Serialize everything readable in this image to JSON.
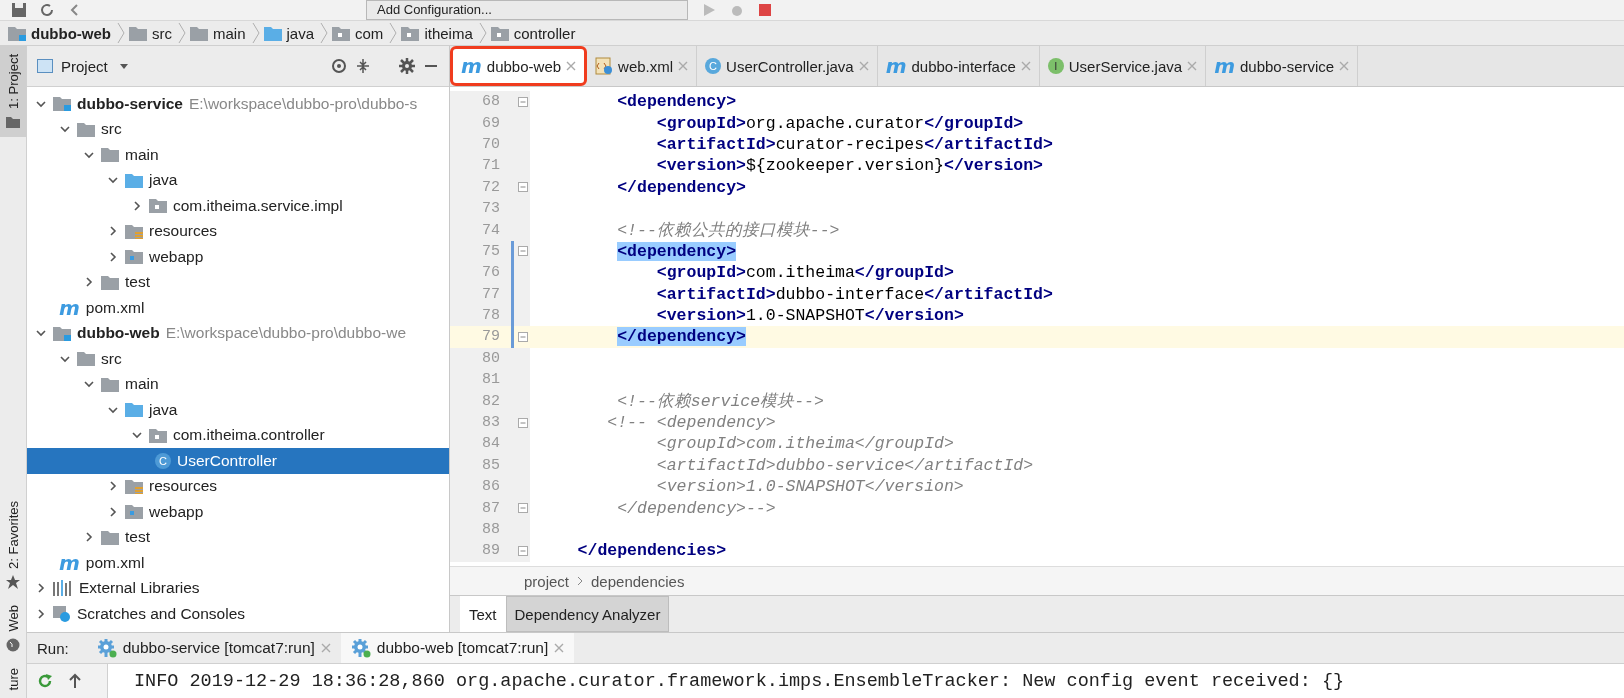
{
  "toolbar": {
    "run_config": "Add Configuration..."
  },
  "breadcrumb": [
    {
      "label": "dubbo-web",
      "kind": "module"
    },
    {
      "label": "src",
      "kind": "folder"
    },
    {
      "label": "main",
      "kind": "folder"
    },
    {
      "label": "java",
      "kind": "source"
    },
    {
      "label": "com",
      "kind": "package"
    },
    {
      "label": "itheima",
      "kind": "package"
    },
    {
      "label": "controller",
      "kind": "package"
    }
  ],
  "tool_strip": [
    {
      "label": "1: Project",
      "kind": "project",
      "selected": true
    },
    {
      "label": "2: Favorites",
      "kind": "favorites",
      "selected": false
    },
    {
      "label": "Web",
      "kind": "web",
      "selected": false
    },
    {
      "label": "ture",
      "kind": "structure",
      "selected": false
    }
  ],
  "project_panel": {
    "title": "Project",
    "tree": [
      {
        "label": "dubbo-service",
        "kind": "module",
        "path": "E:\\workspace\\dubbo-pro\\dubbo-s",
        "expanded": true,
        "selected": false,
        "children": [
          {
            "label": "src",
            "kind": "folder",
            "expanded": true,
            "selected": false,
            "children": [
              {
                "label": "main",
                "kind": "folder",
                "expanded": true,
                "selected": false,
                "children": [
                  {
                    "label": "java",
                    "kind": "source",
                    "expanded": true,
                    "selected": false,
                    "children": [
                      {
                        "label": "com.itheima.service.impl",
                        "kind": "package",
                        "expanded": false,
                        "selected": false
                      }
                    ]
                  },
                  {
                    "label": "resources",
                    "kind": "resources",
                    "expanded": false,
                    "selected": false
                  },
                  {
                    "label": "webapp",
                    "kind": "webapp",
                    "expanded": false,
                    "selected": false
                  }
                ]
              },
              {
                "label": "test",
                "kind": "folder",
                "expanded": false,
                "selected": false
              }
            ]
          },
          {
            "label": "pom.xml",
            "kind": "maven",
            "icon_text": "m",
            "selected": false
          }
        ]
      },
      {
        "label": "dubbo-web",
        "kind": "module",
        "path": "E:\\workspace\\dubbo-pro\\dubbo-we",
        "expanded": true,
        "selected": false,
        "children": [
          {
            "label": "src",
            "kind": "folder",
            "expanded": true,
            "selected": false,
            "children": [
              {
                "label": "main",
                "kind": "folder",
                "expanded": true,
                "selected": false,
                "children": [
                  {
                    "label": "java",
                    "kind": "source",
                    "expanded": true,
                    "selected": false,
                    "children": [
                      {
                        "label": "com.itheima.controller",
                        "kind": "package",
                        "expanded": true,
                        "selected": false,
                        "children": [
                          {
                            "label": "UserController",
                            "kind": "class",
                            "icon_text": "C",
                            "selected": true
                          }
                        ]
                      }
                    ]
                  },
                  {
                    "label": "resources",
                    "kind": "resources",
                    "expanded": false,
                    "selected": false
                  },
                  {
                    "label": "webapp",
                    "kind": "webapp",
                    "expanded": false,
                    "selected": false
                  }
                ]
              },
              {
                "label": "test",
                "kind": "folder",
                "expanded": false,
                "selected": false
              }
            ]
          },
          {
            "label": "pom.xml",
            "kind": "maven",
            "icon_text": "m",
            "selected": false
          }
        ]
      },
      {
        "label": "External Libraries",
        "kind": "libraries",
        "expanded": false,
        "selected": false
      },
      {
        "label": "Scratches and Consoles",
        "kind": "scratches",
        "expanded": false,
        "selected": false
      }
    ]
  },
  "editor": {
    "tabs": [
      {
        "label": "dubbo-web",
        "kind": "maven",
        "icon_text": "m",
        "selected": true,
        "highlighted": true
      },
      {
        "label": "web.xml",
        "kind": "xml",
        "selected": false,
        "highlighted": false
      },
      {
        "label": "UserController.java",
        "kind": "class",
        "icon_text": "C",
        "selected": false,
        "highlighted": false
      },
      {
        "label": "dubbo-interface",
        "kind": "maven",
        "icon_text": "m",
        "selected": false,
        "highlighted": false
      },
      {
        "label": "UserService.java",
        "kind": "interface",
        "icon_text": "I",
        "selected": false,
        "highlighted": false
      },
      {
        "label": "dubbo-service",
        "kind": "maven",
        "icon_text": "m",
        "selected": false,
        "highlighted": false
      }
    ],
    "lines": [
      {
        "number": "68",
        "fold": true,
        "modified": false,
        "current": false,
        "tokens": [
          {
            "kind": "tag",
            "text": "        <dependency>"
          }
        ]
      },
      {
        "number": "69",
        "fold": false,
        "modified": false,
        "current": false,
        "tokens": [
          {
            "kind": "tag",
            "text": "            <groupId>"
          },
          {
            "kind": "plain",
            "text": "org.apache.curator"
          },
          {
            "kind": "tag",
            "text": "</groupId>"
          }
        ]
      },
      {
        "number": "70",
        "fold": false,
        "modified": false,
        "current": false,
        "tokens": [
          {
            "kind": "tag",
            "text": "            <artifactId>"
          },
          {
            "kind": "plain",
            "text": "curator-recipes"
          },
          {
            "kind": "tag",
            "text": "</artifactId>"
          }
        ]
      },
      {
        "number": "71",
        "fold": false,
        "modified": false,
        "current": false,
        "tokens": [
          {
            "kind": "tag",
            "text": "            <version>"
          },
          {
            "kind": "plain",
            "text": "${zookeeper.version}"
          },
          {
            "kind": "tag",
            "text": "</version>"
          }
        ]
      },
      {
        "number": "72",
        "fold": true,
        "modified": false,
        "current": false,
        "tokens": [
          {
            "kind": "tag",
            "text": "        </dependency>"
          }
        ]
      },
      {
        "number": "73",
        "fold": false,
        "modified": false,
        "current": false
      },
      {
        "number": "74",
        "fold": false,
        "modified": false,
        "current": false,
        "tokens": [
          {
            "kind": "comment",
            "text": "        <!--依赖公共的接口模块-->"
          }
        ]
      },
      {
        "number": "75",
        "fold": true,
        "modified": true,
        "current": false,
        "tokens": [
          {
            "kind": "match",
            "text": "        <dependency>"
          }
        ]
      },
      {
        "number": "76",
        "fold": false,
        "modified": true,
        "current": false,
        "tokens": [
          {
            "kind": "tag",
            "text": "            <groupId>"
          },
          {
            "kind": "plain",
            "text": "com.itheima"
          },
          {
            "kind": "tag",
            "text": "</groupId>"
          }
        ]
      },
      {
        "number": "77",
        "fold": false,
        "modified": true,
        "current": false,
        "tokens": [
          {
            "kind": "tag",
            "text": "            <artifactId>"
          },
          {
            "kind": "plain",
            "text": "dubbo-interface"
          },
          {
            "kind": "tag",
            "text": "</artifactId>"
          }
        ]
      },
      {
        "number": "78",
        "fold": false,
        "modified": true,
        "current": false,
        "tokens": [
          {
            "kind": "tag",
            "text": "            <version>"
          },
          {
            "kind": "plain",
            "text": "1.0-SNAPSHOT"
          },
          {
            "kind": "tag",
            "text": "</version>"
          }
        ]
      },
      {
        "number": "79",
        "fold": true,
        "modified": true,
        "current": true,
        "tokens": [
          {
            "kind": "match",
            "text": "        </dependency>"
          }
        ]
      },
      {
        "number": "80",
        "fold": false,
        "modified": false,
        "current": false
      },
      {
        "number": "81",
        "fold": false,
        "modified": false,
        "current": false
      },
      {
        "number": "82",
        "fold": false,
        "modified": false,
        "current": false,
        "tokens": [
          {
            "kind": "comment",
            "text": "        <!--依赖service模块-->"
          }
        ]
      },
      {
        "number": "83",
        "fold": true,
        "modified": false,
        "current": false,
        "tokens": [
          {
            "kind": "comment",
            "text": "       <!-- <dependency>"
          }
        ]
      },
      {
        "number": "84",
        "fold": false,
        "modified": false,
        "current": false,
        "tokens": [
          {
            "kind": "comment",
            "text": "            <groupId>com.itheima</groupId>"
          }
        ]
      },
      {
        "number": "85",
        "fold": false,
        "modified": false,
        "current": false,
        "tokens": [
          {
            "kind": "comment",
            "text": "            <artifactId>dubbo-service</artifactId>"
          }
        ]
      },
      {
        "number": "86",
        "fold": false,
        "modified": false,
        "current": false,
        "tokens": [
          {
            "kind": "comment",
            "text": "            <version>1.0-SNAPSHOT</version>"
          }
        ]
      },
      {
        "number": "87",
        "fold": true,
        "modified": false,
        "current": false,
        "tokens": [
          {
            "kind": "comment",
            "text": "        </dependency>-->"
          }
        ]
      },
      {
        "number": "88",
        "fold": false,
        "modified": false,
        "current": false
      },
      {
        "number": "89",
        "fold": true,
        "modified": false,
        "current": false,
        "tokens": [
          {
            "kind": "tag",
            "text": "    </dependencies>"
          }
        ]
      }
    ],
    "path": [
      "project",
      "dependencies"
    ],
    "mode_tabs": [
      {
        "label": "Text",
        "selected": true
      },
      {
        "label": "Dependency Analyzer",
        "selected": false
      }
    ]
  },
  "run": {
    "label": "Run:",
    "tabs": [
      {
        "label": "dubbo-service [tomcat7:run]",
        "selected": false
      },
      {
        "label": "dubbo-web [tomcat7:run]",
        "selected": true
      }
    ],
    "console": [
      "INFO 2019-12-29 18:36:28,860 org.apache.curator.framework.imps.EnsembleTracker: New config event received: {}"
    ]
  }
}
